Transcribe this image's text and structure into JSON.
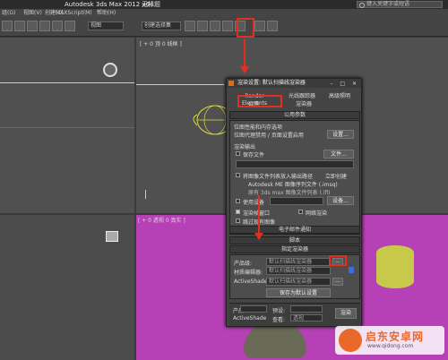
{
  "titlebar": {
    "app": "Autodesk 3ds Max  2012 x64",
    "doc": "无标题",
    "search_placeholder": "键入关键字或短语"
  },
  "menubar": {
    "items": [
      "组(G)",
      "视图(V)",
      "创建(C)",
      "MAXScript(M)",
      "帮助(H)"
    ]
  },
  "toolbar": {
    "view_dropdown": "视图",
    "sel_dropdown": "创建选择集"
  },
  "viewports": {
    "top_label": "[ + 0 顶 0 线框 ]",
    "persp_label": "[ + 0 透视 0 真实 ]"
  },
  "dialog": {
    "title": "渲染设置: 默认扫描线渲染器",
    "tabs_row1": [
      "Render Elements",
      "光线跟踪器",
      "高级照明"
    ],
    "tabs_row2": [
      "公用",
      "渲染器"
    ],
    "section1_title": "公用参数",
    "line1": "位图性能和内存选项",
    "line2": "位图代理禁用 / 页面设置启用",
    "setup_btn": "设置...",
    "render_output": "渲染输出",
    "save_file": "保存文件",
    "files_btn": "文件...",
    "put_image": "将图像文件列表放入输出路径",
    "create_now": "立即创建",
    "opt1": "Autodesk ME 图像序列文件 (.imsq)",
    "opt2": "原有 3ds max 图像文件列表 (.ifl)",
    "use_device": "使用设备",
    "devices_btn": "设备...",
    "render_frame": "渲染帧窗口",
    "net_render": "网络渲染",
    "skip_existing": "跳过现有图像",
    "rollouts": [
      "电子邮件通知",
      "脚本",
      "指定渲染器"
    ],
    "production_label": "产品级:",
    "production_value": "默认扫描线渲染器",
    "material_editor_label": "材质编辑器:",
    "material_editor_value": "默认扫描线渲染器",
    "activeshade_label": "ActiveShade:",
    "activeshade_value": "默认扫描线渲染器",
    "save_default_btn": "保存为默认设置",
    "footer_product": "产品",
    "footer_preset": "预设:",
    "footer_activeshade": "ActiveShade",
    "footer_view": "查看:",
    "footer_view_value": "透视",
    "footer_render": "渲染"
  },
  "watermark": {
    "title": "启东安卓网",
    "url": "www.qidong.com"
  },
  "colors": {
    "accent_red": "#e03020",
    "persp_bg": "#b640b6",
    "wire_yellow": "#d8d84a"
  }
}
